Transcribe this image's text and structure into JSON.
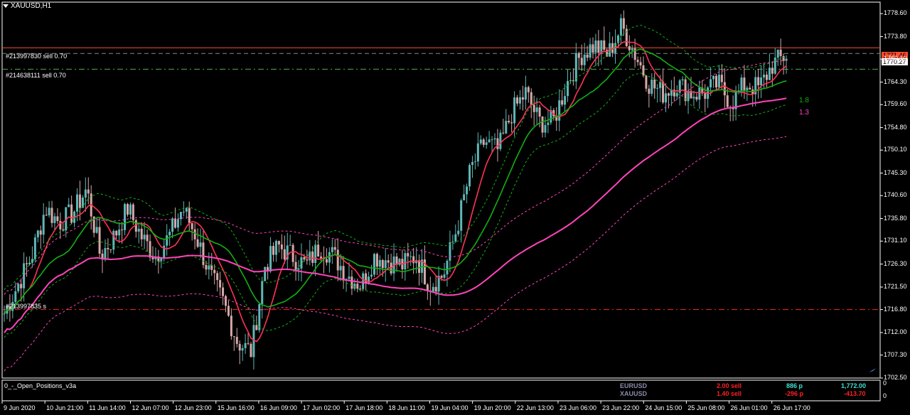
{
  "chart_header": {
    "symbol": "XAUUSD,H1"
  },
  "orders": [
    {
      "label": "#213997830 sell 0.70",
      "price": 1771.46
    },
    {
      "label": "#214638111 sell 0.70",
      "price": 1767.0
    },
    {
      "label": "#213997835 s",
      "price": 1716.8
    }
  ],
  "price_axis": {
    "labels": [
      "1778.60",
      "1773.80",
      "1769.10",
      "1764.30",
      "1759.60",
      "1754.80",
      "1750.10",
      "1745.30",
      "1740.60",
      "1735.80",
      "1731.10",
      "1726.30",
      "1721.50",
      "1716.80",
      "1712.00",
      "1707.30",
      "1702.50"
    ],
    "bid_tag": "1771.46",
    "ask_tag": "1770.27"
  },
  "time_axis": {
    "labels": [
      "9 Jun 2020",
      "10 Jun 21:00",
      "11 Jun 14:00",
      "12 Jun 07:00",
      "12 Jun 23:00",
      "15 Jun 16:00",
      "16 Jun 09:00",
      "17 Jun 02:00",
      "17 Jun 18:00",
      "18 Jun 11:00",
      "19 Jun 04:00",
      "19 Jun 20:00",
      "22 Jun 13:00",
      "23 Jun 06:00",
      "23 Jun 22:00",
      "24 Jun 15:00",
      "25 Jun 08:00",
      "26 Jun 01:00",
      "26 Jun 17:00"
    ]
  },
  "ma_labels": {
    "green": "1.8",
    "pink": "1.3"
  },
  "indicator": {
    "name": "0_-_Open_Positions_v3a",
    "axis_top": "0",
    "axis_bottom": "0"
  },
  "positions": [
    {
      "symbol": "EURUSD",
      "lots": "2.00 sell",
      "points": "886 p",
      "profit": "1,772.00"
    },
    {
      "symbol": "XAUUSD",
      "lots": "1.40 sell",
      "points": "-296 p",
      "profit": "-413.70"
    }
  ],
  "colors": {
    "bull": "#5fb7b7",
    "bear": "#d6a8a8",
    "ma_fast": "#ff3355",
    "ma_green": "#12b012",
    "ma_pink": "#ff44bb",
    "sell_line": "#ff4c2c",
    "level_green": "#55a855",
    "level_red": "#ff2222"
  },
  "chart_data": {
    "type": "candlestick",
    "ylim": [
      1702.5,
      1781.0
    ],
    "approx_close_path": [
      1716,
      1722,
      1728,
      1738,
      1735,
      1737,
      1742,
      1728,
      1732,
      1738,
      1732,
      1728,
      1732,
      1738,
      1732,
      1724,
      1718,
      1710,
      1708,
      1726,
      1730,
      1728,
      1726,
      1730,
      1728,
      1724,
      1722,
      1728,
      1727,
      1726,
      1728,
      1722,
      1724,
      1734,
      1746,
      1752,
      1750,
      1758,
      1762,
      1756,
      1756,
      1764,
      1770,
      1772,
      1770,
      1776,
      1770,
      1764,
      1762,
      1764,
      1762,
      1762,
      1764,
      1760,
      1764,
      1763,
      1768,
      1770
    ]
  }
}
